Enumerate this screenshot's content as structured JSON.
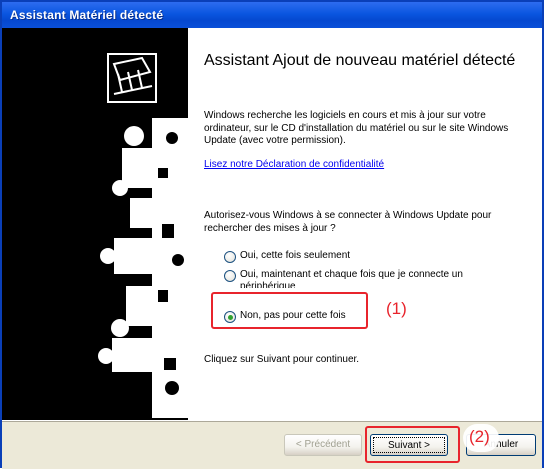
{
  "window": {
    "title": "Assistant Matériel détecté"
  },
  "wizard": {
    "heading": "Assistant Ajout de nouveau matériel détecté",
    "description": "Windows recherche les logiciels en cours et mis à jour sur votre ordinateur, sur le CD d'installation du matériel ou sur le site Windows Update (avec votre permission).",
    "privacy_link": "Lisez notre Déclaration de confidentialité",
    "question": "Autorisez-vous Windows à se connecter à Windows Update pour rechercher des mises à jour ?",
    "options": [
      {
        "label": "Oui, cette fois seulement",
        "checked": false
      },
      {
        "label": "Oui, maintenant et chaque fois que je connecte un périphérique",
        "checked": false
      },
      {
        "label": "Non, pas pour cette fois",
        "checked": true
      }
    ],
    "continue_text": "Cliquez sur Suivant pour continuer."
  },
  "buttons": {
    "back": "< Précédent",
    "next": "Suivant >",
    "cancel": "Annuler"
  },
  "annotations": {
    "one": "(1)",
    "two": "(2)"
  },
  "colors": {
    "titlebar": "#0a56e0",
    "highlight": "#e8242c",
    "selected_radio": "#2fa12f"
  }
}
